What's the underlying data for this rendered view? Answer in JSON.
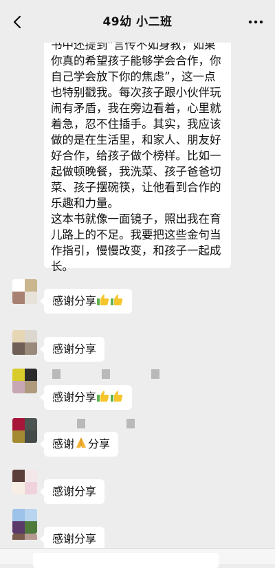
{
  "header": {
    "title": "49幼  小二班",
    "back_icon": "chevron-left-icon",
    "more_icon": "ellipsis-icon"
  },
  "long_message": {
    "paragraph1": "书中还提到“言传不如身教，如果你真的希望孩子能够学会合作，你自己学会放下你的焦虑”，这一点也特别戳我。每次孩子跟小伙伴玩闹有矛盾，我在旁边看着，心里就着急，忍不住插手。其实，我应该做的是在生活里，和家人、朋友好好合作，给孩子做个榜样。比如一起做顿晚餐，我洗菜、孩子爸爸切菜、孩子摆碗筷，让他看到合作的乐趣和力量。",
    "paragraph2": "这本书就像一面镜子，照出我在育儿路上的不足。我要把这些金句当作指引，慢慢改变，和孩子一起成长。"
  },
  "messages": [
    {
      "text": "感谢分享",
      "emoji": "thumbs-up-icon x2"
    },
    {
      "text": "感谢分享",
      "emoji": ""
    },
    {
      "text": "感谢分享",
      "emoji": "thumbs-up-icon x2"
    },
    {
      "text_before": "感谢",
      "text_after": "分享",
      "emoji": "folded-hands-icon"
    },
    {
      "text": "感谢分享",
      "emoji": ""
    },
    {
      "text": "感谢分享",
      "emoji": ""
    }
  ],
  "colors": {
    "background": "#ededed",
    "bubble": "#ffffff",
    "thumb_yellow": "#f5c52b",
    "thumb_green": "#6fbf4a"
  }
}
